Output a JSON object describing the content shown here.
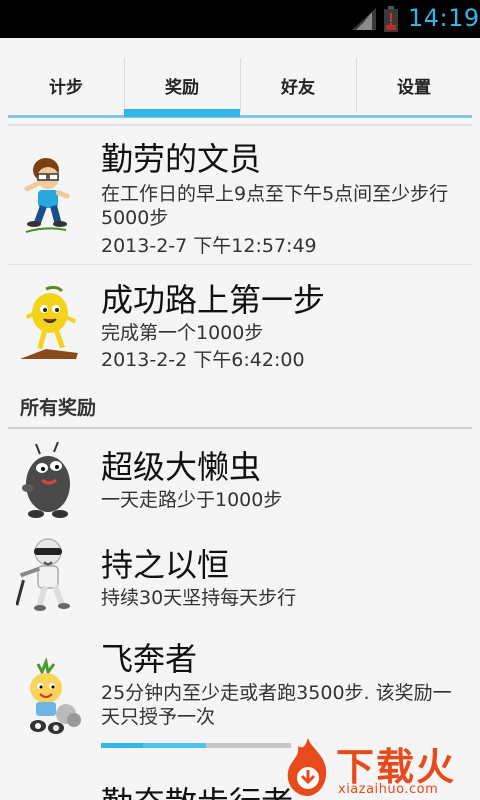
{
  "status_bar": {
    "time": "14:19"
  },
  "tabs": [
    {
      "label": "计步"
    },
    {
      "label": "奖励",
      "active": true
    },
    {
      "label": "好友"
    },
    {
      "label": "设置"
    }
  ],
  "earned_awards": [
    {
      "title": "勤劳的文员",
      "desc": "在工作日的早上9点至下午5点间至少步行5000步",
      "date": "2013-2-7 下午12:57:49",
      "icon": "clerk-character-icon"
    },
    {
      "title": "成功路上第一步",
      "desc": "完成第一个1000步",
      "date": "2013-2-2 下午6:42:00",
      "icon": "lemon-character-icon"
    }
  ],
  "all_awards_header": "所有奖励",
  "all_awards": [
    {
      "title": "超级大懒虫",
      "desc": "一天走路少于1000步",
      "icon": "lazy-bug-icon"
    },
    {
      "title": "持之以恒",
      "desc": "持续30天坚持每天步行",
      "icon": "persistent-walker-icon"
    },
    {
      "title": "飞奔者",
      "desc": "25分钟内至少走或者跑3500步. 该奖励一天只授予一次",
      "icon": "runner-character-icon",
      "progress": 0.55
    },
    {
      "title": "勤奋散步行者",
      "icon": "partial-item"
    }
  ],
  "watermark": {
    "text": "下载火",
    "sub": "xiazaihuo.com"
  },
  "colors": {
    "accent": "#33b5e5",
    "watermark": "#e84a1b"
  }
}
